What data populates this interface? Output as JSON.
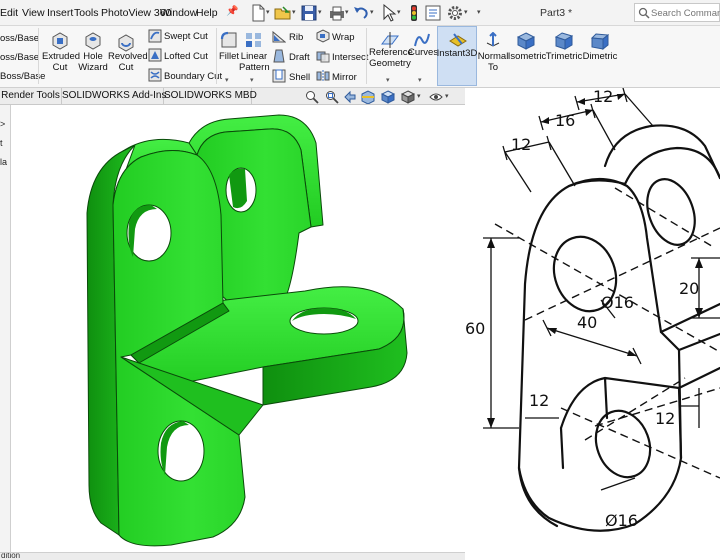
{
  "menu": {
    "items": [
      "Edit",
      "View",
      "Insert",
      "Tools",
      "PhotoView 360",
      "Window",
      "Help"
    ]
  },
  "document": {
    "title": "Part3 *"
  },
  "search": {
    "placeholder": "Search Commands"
  },
  "ribbon": {
    "boss_items": [
      "oss/Base",
      "oss/Base",
      "Boss/Base"
    ],
    "extruded_cut": [
      "Extruded",
      "Cut"
    ],
    "hole_wizard": [
      "Hole",
      "Wizard"
    ],
    "revolved_cut": [
      "Revolved",
      "Cut"
    ],
    "swept_cut": "Swept Cut",
    "lofted_cut": "Lofted Cut",
    "boundary_cut": "Boundary Cut",
    "fillet": "Fillet",
    "linear_pattern": [
      "Linear",
      "Pattern"
    ],
    "rib": "Rib",
    "draft": "Draft",
    "shell": "Shell",
    "wrap": "Wrap",
    "intersect": "Intersect",
    "mirror": "Mirror",
    "reference_geometry": [
      "Reference",
      "Geometry"
    ],
    "curves": "Curves",
    "instant3d": "Instant3D",
    "normal_to": [
      "Normal",
      "To"
    ],
    "isometric": "Isometric",
    "trimetric": "Trimetric",
    "dimetric": "Dimetric"
  },
  "tabs": [
    "Render Tools",
    "SOLIDWORKS Add-Ins",
    "SOLIDWORKS MBD"
  ],
  "left_panel": {
    "lines": [
      ">",
      "t",
      "la"
    ]
  },
  "status_bar": {
    "text": "dition"
  },
  "drawing": {
    "dims": {
      "top_12": "12",
      "top_16": "16",
      "left_12": "12",
      "height_60": "60",
      "hole_16_upper": "Ø16",
      "width_40": "40",
      "right_20": "20",
      "inner_12_left": "12",
      "inner_12_right": "12",
      "hole_16_lower": "Ø16"
    }
  },
  "colors": {
    "part_light": "#33dd33",
    "part_mid": "#1fc41f",
    "part_dark": "#119911",
    "part_edge": "#0a4a0a",
    "accent_blue": "#3a6fc4",
    "instant3d_highlight": "#cfdff3"
  }
}
